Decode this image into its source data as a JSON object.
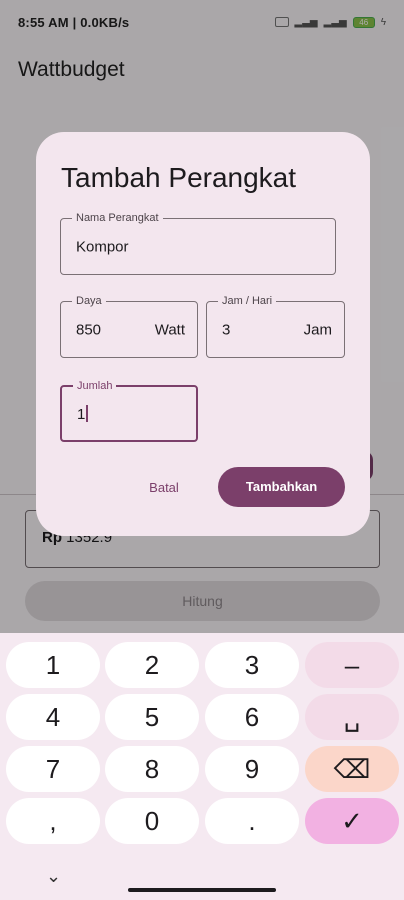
{
  "status_bar": {
    "time": "8:55 AM",
    "network_speed": "0.0KB/s",
    "battery_level": "46"
  },
  "app": {
    "title": "Wattbudget"
  },
  "background": {
    "result_prefix": "Rp",
    "result_value": "1352.9",
    "hitung_label": "Hitung"
  },
  "dialog": {
    "title": "Tambah Perangkat",
    "nama_label": "Nama Perangkat",
    "nama_value": "Kompor",
    "daya_label": "Daya",
    "daya_value": "850",
    "daya_suffix": "Watt",
    "jam_label": "Jam / Hari",
    "jam_value": "3",
    "jam_suffix": "Jam",
    "jumlah_label": "Jumlah",
    "jumlah_value": "1",
    "cancel_label": "Batal",
    "confirm_label": "Tambahkan"
  },
  "keyboard": {
    "keys": [
      "1",
      "2",
      "3",
      "–",
      "4",
      "5",
      "6",
      "␣",
      "7",
      "8",
      "9",
      "⌫",
      ",",
      "0",
      ".",
      "✓"
    ],
    "collapse_icon": "chevron-down-icon"
  },
  "colors": {
    "primary": "#7b3f6a",
    "dialog_surface": "#f3e6ee",
    "keyboard_bg": "#f5e9f1",
    "done_key": "#f2b1e2",
    "backspace_key": "#fbd6c9"
  }
}
